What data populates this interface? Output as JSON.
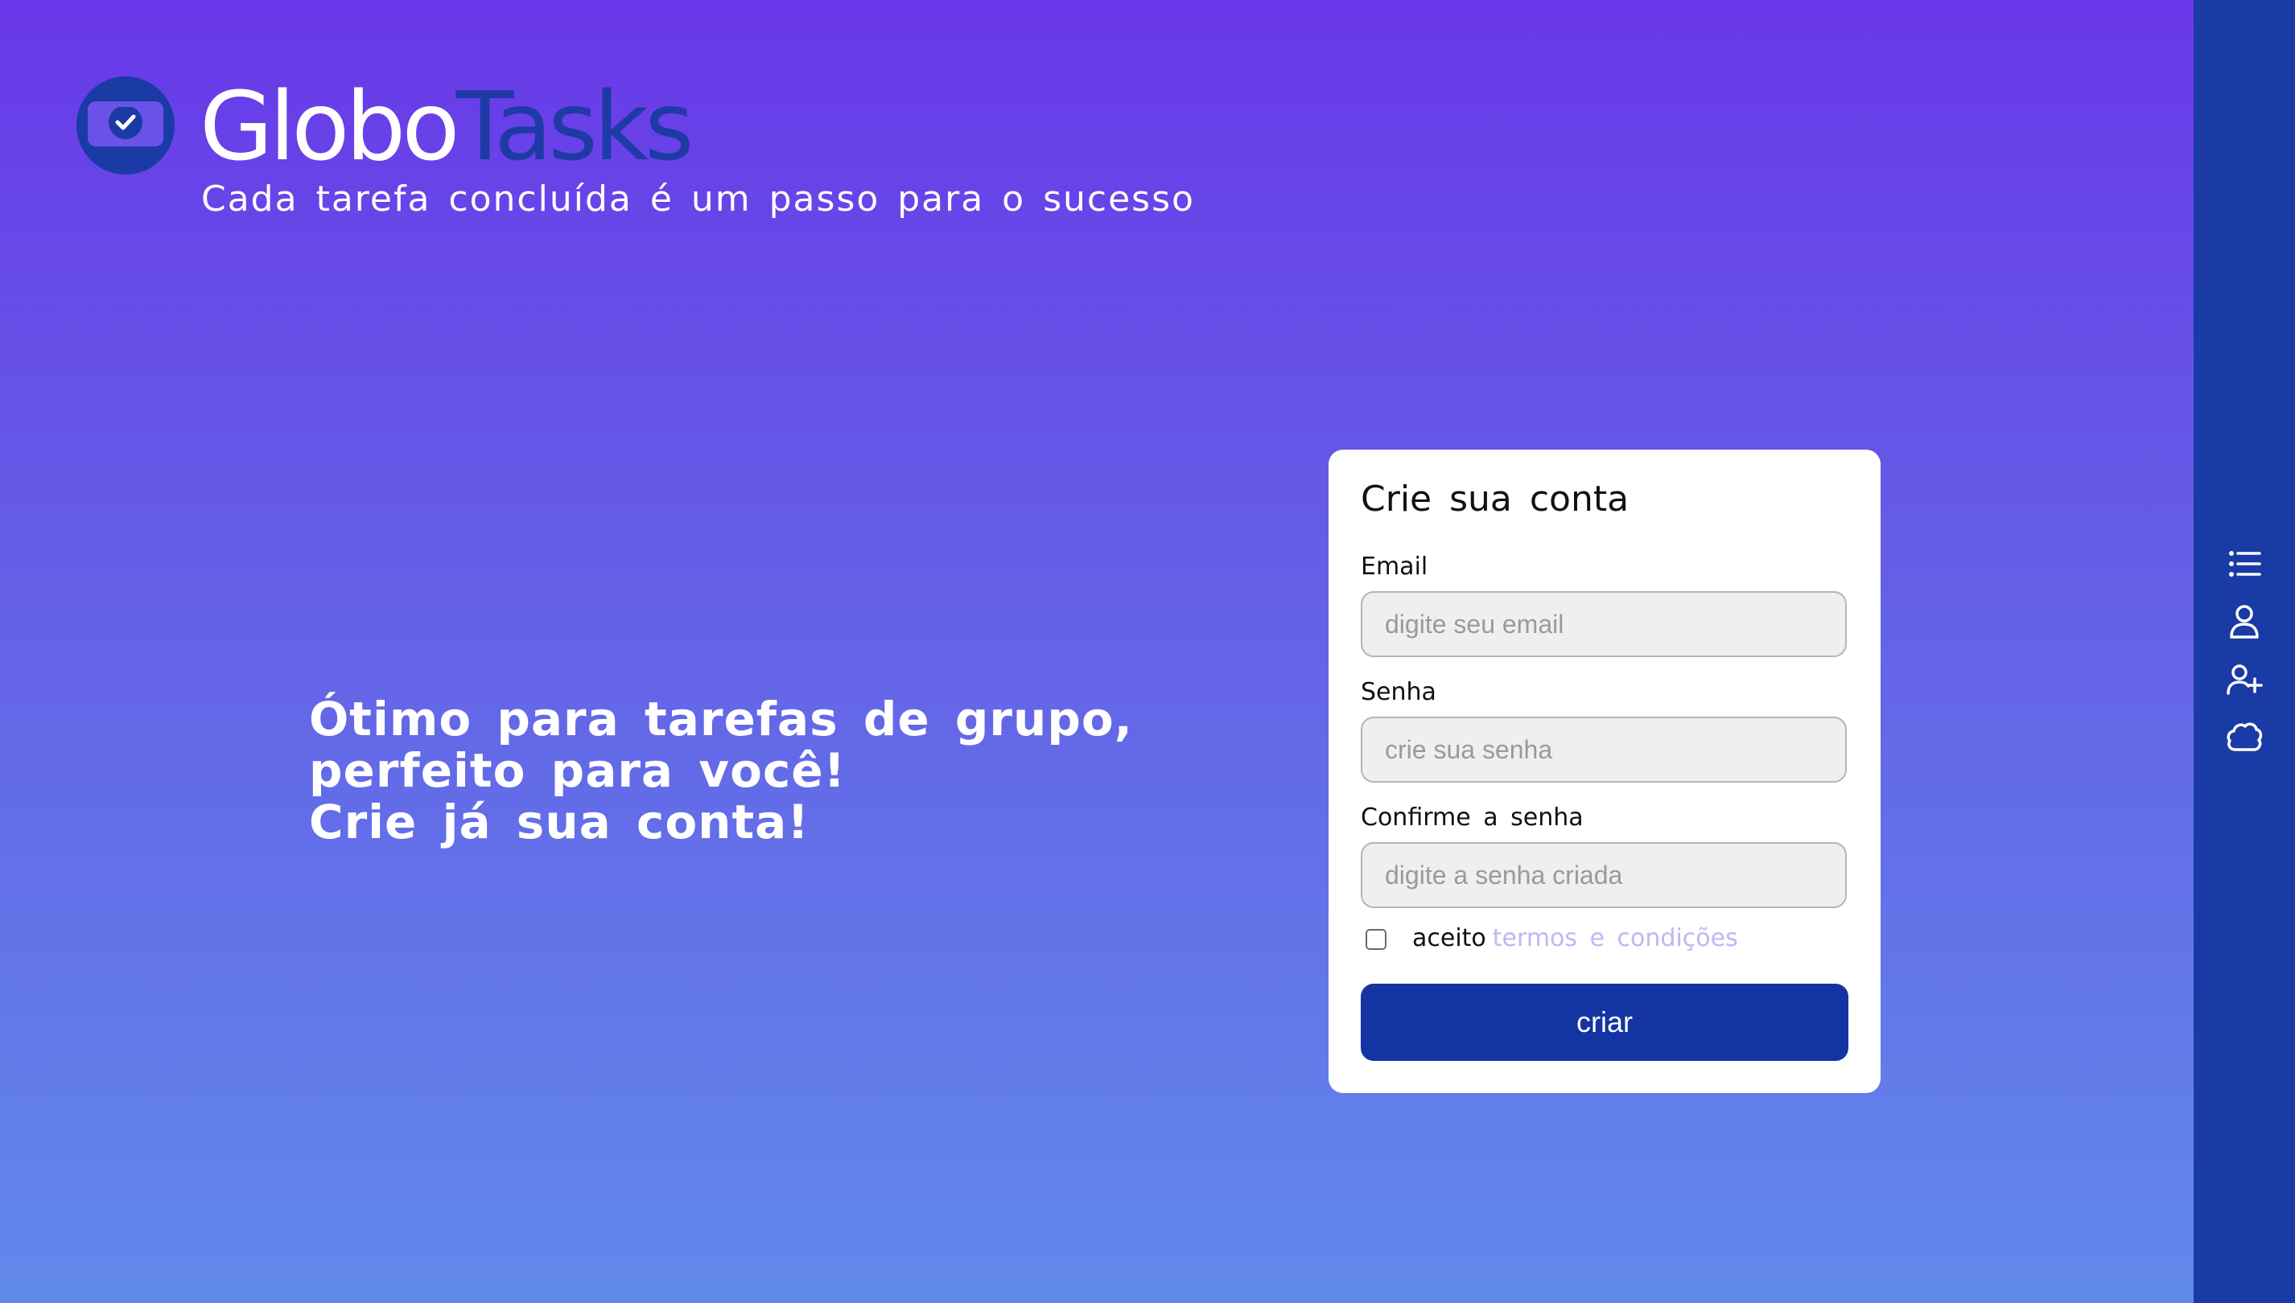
{
  "brand": {
    "name_part1": "Globo",
    "name_part2": "Tasks",
    "tagline": "Cada tarefa concluída é um passo para o sucesso",
    "logo_icon": "monitor-check-icon"
  },
  "hero": {
    "lines": [
      "Ótimo para tarefas de grupo,",
      "perfeito para você!",
      "Crie já sua conta!"
    ]
  },
  "signup_form": {
    "title": "Crie sua conta",
    "email": {
      "label": "Email",
      "value": "",
      "placeholder": "digite seu email"
    },
    "password": {
      "label": "Senha",
      "value": "",
      "placeholder": "crie sua senha"
    },
    "confirm_password": {
      "label": "Confirme a senha",
      "value": "",
      "placeholder": "digite a senha criada"
    },
    "terms": {
      "checked": false,
      "prefix": "aceito",
      "link_text": "termos e condições"
    },
    "submit_label": "criar"
  },
  "sidebar": {
    "items": [
      {
        "icon": "list-icon"
      },
      {
        "icon": "user-icon"
      },
      {
        "icon": "user-plus-icon"
      },
      {
        "icon": "cloud-icon"
      }
    ]
  },
  "colors": {
    "background_top": "#6937e9",
    "background_bottom": "#6189eb",
    "brand_blue": "#1a3aa5",
    "button_blue": "#1534a3",
    "link_lavender": "#c3b5f2",
    "card_background": "#ffffff"
  }
}
